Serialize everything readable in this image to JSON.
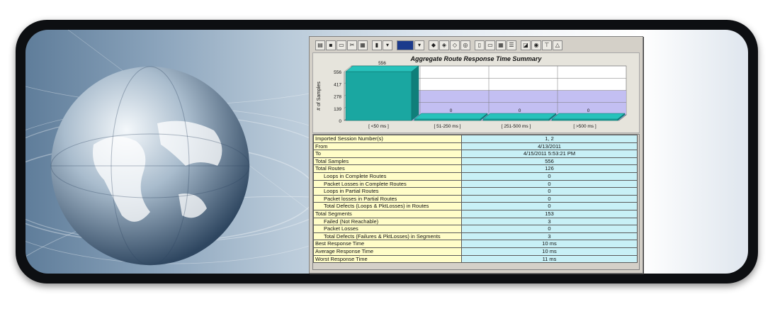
{
  "toolbar": {
    "icons": [
      "open-icon",
      "save-icon",
      "print-preview-icon",
      "cut-icon",
      "print-icon",
      "chart-type-icon",
      "dropdown-arrow-icon",
      "color-bar-icon",
      "dropdown-arrow-icon",
      "car-icon",
      "network-icon",
      "filter-icon",
      "zoom-icon",
      "document-icon",
      "copy-icon",
      "grid-icon",
      "list-icon",
      "three-d-icon",
      "find-icon",
      "tools-icon",
      "triangle-chart-icon"
    ]
  },
  "chart_data": {
    "type": "bar",
    "title": "Aggregate Route Response Time Summary",
    "xlabel": "",
    "ylabel": "# of Samples",
    "categories": [
      "[ <50 ms ]",
      "[ 51-250 ms ]",
      "[ 251-500 ms ]",
      "[ >500 ms ]"
    ],
    "values": [
      556,
      0,
      0,
      0
    ],
    "data_labels": [
      "556",
      "0",
      "0",
      "0"
    ],
    "yticks": [
      "0",
      "139",
      "278",
      "417",
      "556"
    ],
    "ylim": [
      0,
      556
    ],
    "grid": true,
    "colors": {
      "bar": "#1aa7a1",
      "floor": "#b8b4f0",
      "wall": "#ffffff"
    }
  },
  "summary": {
    "rows": [
      {
        "label": "Imported Session Number(s)",
        "value": "1, 2",
        "indent": false
      },
      {
        "label": "From",
        "value": "4/13/2011",
        "indent": false
      },
      {
        "label": "To",
        "value": "4/15/2011 5:53:21 PM",
        "indent": false
      },
      {
        "label": "Total Samples",
        "value": "556",
        "indent": false
      },
      {
        "label": "Total Routes",
        "value": "126",
        "indent": false
      },
      {
        "label": "Loops in Complete Routes",
        "value": "0",
        "indent": true
      },
      {
        "label": "Packet Losses in Complete Routes",
        "value": "0",
        "indent": true
      },
      {
        "label": "Loops in Partial Routes",
        "value": "0",
        "indent": true
      },
      {
        "label": "Packet losses in Partial Routes",
        "value": "0",
        "indent": true
      },
      {
        "label": "Total Defects (Loops & PktLosses) in Routes",
        "value": "0",
        "indent": true
      },
      {
        "label": "Total Segments",
        "value": "153",
        "indent": false
      },
      {
        "label": "Failed (Not Reachable)",
        "value": "3",
        "indent": true
      },
      {
        "label": "Packet Losses",
        "value": "0",
        "indent": true
      },
      {
        "label": "Total Defects (Failures & PktLosses) in Segments",
        "value": "3",
        "indent": true
      },
      {
        "label": "Best Response Time",
        "value": "10 ms",
        "indent": false
      },
      {
        "label": "Average Response Time",
        "value": "10 ms",
        "indent": false
      },
      {
        "label": "Worst Response Time",
        "value": "11 ms",
        "indent": false
      }
    ]
  }
}
